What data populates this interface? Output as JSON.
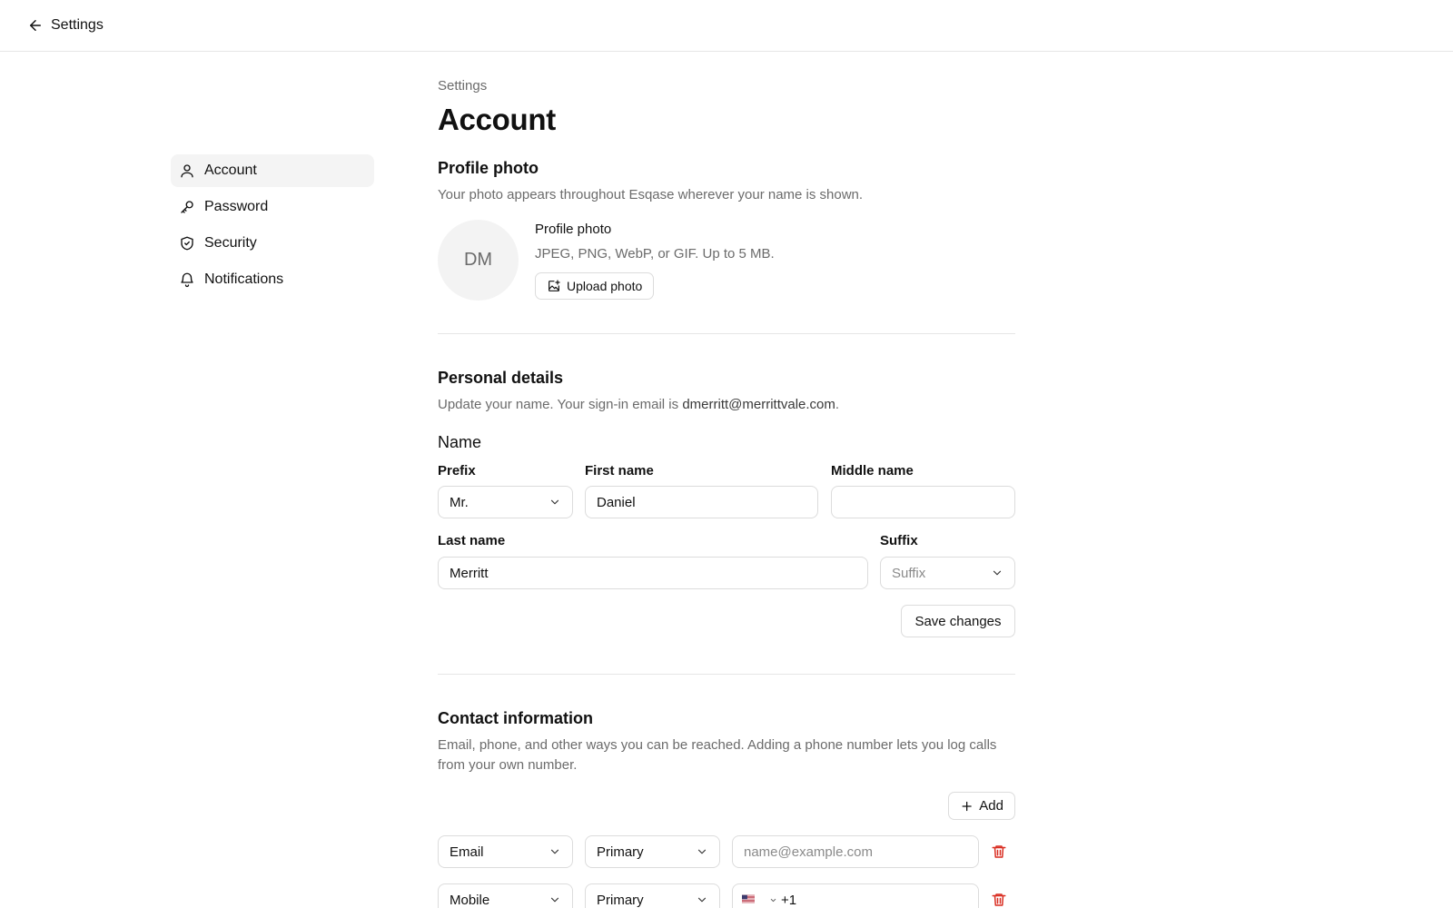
{
  "topbar": {
    "back_label": "Settings"
  },
  "sidebar": {
    "items": [
      {
        "label": "Account",
        "icon": "user-icon",
        "active": true
      },
      {
        "label": "Password",
        "icon": "key-icon",
        "active": false
      },
      {
        "label": "Security",
        "icon": "shield-icon",
        "active": false
      },
      {
        "label": "Notifications",
        "icon": "bell-icon",
        "active": false
      }
    ]
  },
  "header": {
    "breadcrumb": "Settings",
    "title": "Account"
  },
  "profile_photo": {
    "title": "Profile photo",
    "description": "Your photo appears throughout Esqase wherever your name is shown.",
    "avatar_initials": "DM",
    "label": "Profile photo",
    "hint": "JPEG, PNG, WebP, or GIF. Up to 5 MB.",
    "upload_label": "Upload photo"
  },
  "personal_details": {
    "title": "Personal details",
    "description_prefix": "Update your name. Your sign-in email is ",
    "email": "dmerritt@merrittvale.com",
    "description_suffix": ".",
    "name_heading": "Name",
    "prefix_label": "Prefix",
    "prefix_value": "Mr.",
    "first_name_label": "First name",
    "first_name_value": "Daniel",
    "middle_name_label": "Middle name",
    "middle_name_value": "",
    "last_name_label": "Last name",
    "last_name_value": "Merritt",
    "suffix_label": "Suffix",
    "suffix_placeholder": "Suffix",
    "save_label": "Save changes"
  },
  "contact_information": {
    "title": "Contact information",
    "description": "Email, phone, and other ways you can be reached. Adding a phone number lets you log calls from your own number.",
    "add_label": "Add",
    "rows": [
      {
        "type": "Email",
        "priority": "Primary",
        "value": "",
        "placeholder": "name@example.com"
      },
      {
        "type": "Mobile",
        "priority": "Primary",
        "country_code": "+1",
        "country": "US"
      }
    ]
  },
  "colors": {
    "text": "#111111",
    "muted": "#6b6b6b",
    "border": "#dcdcdc",
    "danger": "#d92d20",
    "active_bg": "#f4f4f4"
  }
}
